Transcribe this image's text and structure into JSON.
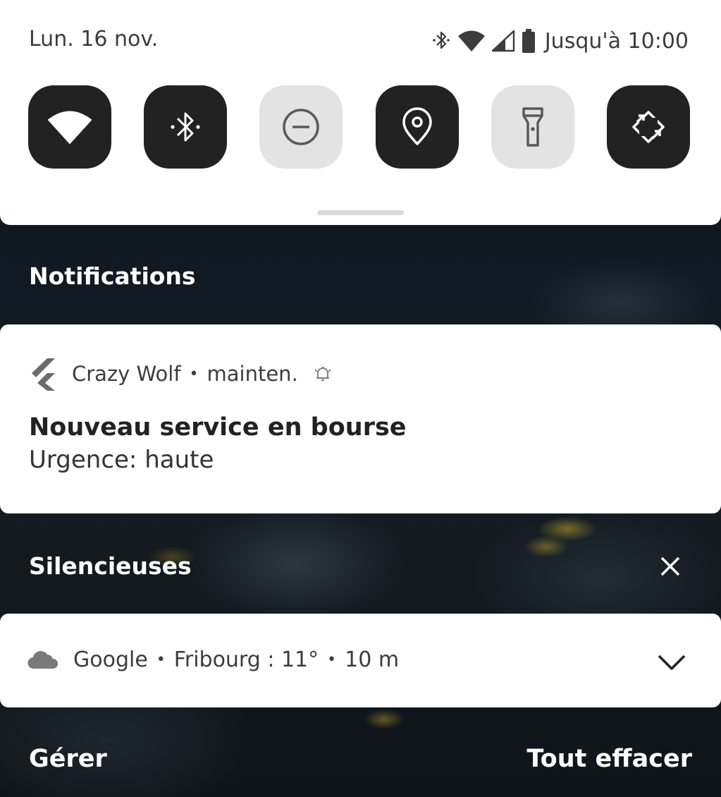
{
  "quick_settings": {
    "date": "Lun. 16 nov.",
    "battery_text": "Jusqu'à 10:00",
    "tiles": [
      {
        "icon": "wifi-icon",
        "state": "on"
      },
      {
        "icon": "bluetooth-icon",
        "state": "on"
      },
      {
        "icon": "do-not-disturb-icon",
        "state": "off"
      },
      {
        "icon": "location-icon",
        "state": "on"
      },
      {
        "icon": "flashlight-icon",
        "state": "off"
      },
      {
        "icon": "auto-rotate-icon",
        "state": "on"
      }
    ]
  },
  "notifications": {
    "section_title": "Notifications",
    "items": [
      {
        "app_name": "Crazy Wolf",
        "time": "mainten.",
        "icon": "flutter-logo-icon",
        "title": "Nouveau service en bourse",
        "text": "Urgence: haute"
      }
    ]
  },
  "silent": {
    "section_title": "Silencieuses",
    "items": [
      {
        "app_name": "Google",
        "summary": "Fribourg : 11°",
        "time": "10 m",
        "icon": "cloud-icon"
      }
    ]
  },
  "footer": {
    "manage_label": "Gérer",
    "clear_all_label": "Tout effacer"
  },
  "colors": {
    "tile_on": "#222222",
    "tile_off": "#e3e3e3",
    "panel": "#ffffff"
  }
}
